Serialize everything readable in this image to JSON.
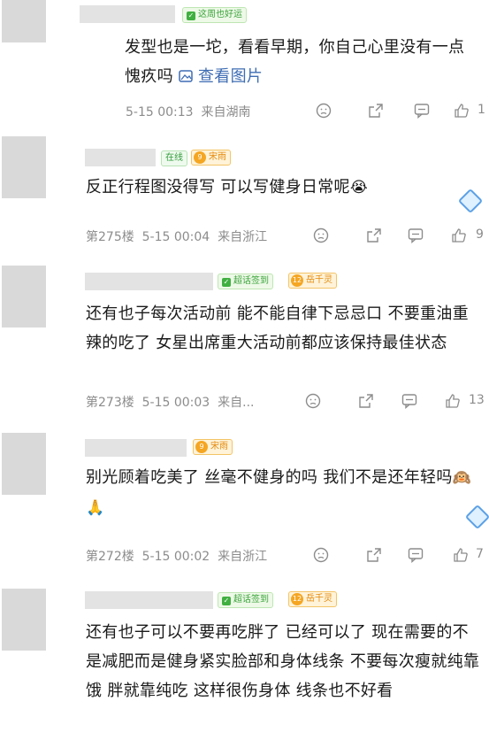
{
  "comments": [
    {
      "badges": [
        {
          "type": "green",
          "label": "这周也好运"
        }
      ],
      "text": "发型也是一坨，看看早期，你自己心里没有一点愧疚吗",
      "link": "查看图片",
      "floor": "",
      "time": "5-15 00:13",
      "location": "来自湖南",
      "likes": "1"
    },
    {
      "badges": [
        {
          "type": "online",
          "label": "在线"
        },
        {
          "type": "orange",
          "level": "9",
          "label": "宋雨"
        }
      ],
      "text": "反正行程图没得写 可以写健身日常呢",
      "emoji": "😭",
      "floor": "第275楼",
      "time": "5-15 00:04",
      "location": "来自浙江",
      "likes": "9"
    },
    {
      "badges": [
        {
          "type": "green",
          "label": "超话签到"
        },
        {
          "type": "orange",
          "level": "12",
          "label": "岳千灵"
        }
      ],
      "text": "还有也子每次活动前 能不能自律下忌忌口 不要重油重辣的吃了 女星出席重大活动前都应该保持最佳状态",
      "floor": "第273楼",
      "time": "5-15 00:03",
      "location": "来自...",
      "likes": "13"
    },
    {
      "badges": [
        {
          "type": "orange",
          "level": "9",
          "label": "宋雨"
        }
      ],
      "text": "别光顾着吃美了 丝毫不健身的吗 我们不是还年轻吗",
      "emoji": "🙉🙏",
      "floor": "第272楼",
      "time": "5-15 00:02",
      "location": "来自浙江",
      "likes": "7"
    },
    {
      "badges": [
        {
          "type": "green",
          "label": "超话签到"
        },
        {
          "type": "orange",
          "level": "12",
          "label": "岳千灵"
        }
      ],
      "text": "还有也子可以不要再吃胖了 已经可以了 现在需要的不是减肥而是健身紧实脸部和身体线条 不要每次瘦就纯靠饿 胖就靠纯吃 这样很伤身体 线条也不好看"
    }
  ],
  "icons": {
    "dislike": "dislike-face-icon",
    "share": "share-icon",
    "comment": "comment-icon",
    "like": "thumbs-up-icon",
    "image": "image-icon",
    "decoration": "diamond-decoration-icon"
  }
}
